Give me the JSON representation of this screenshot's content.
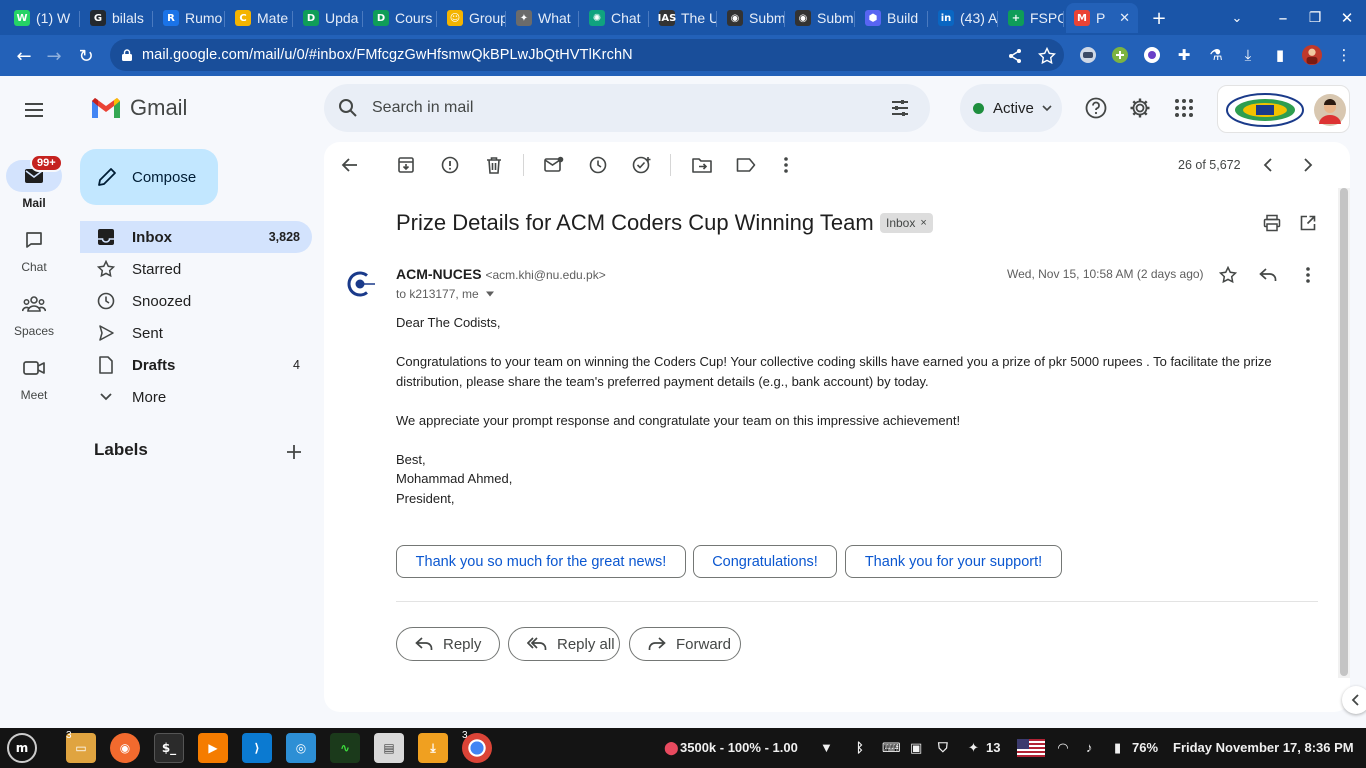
{
  "browser": {
    "tabs": [
      {
        "label": "(1) W",
        "color": "#25d366",
        "glyph": "W"
      },
      {
        "label": "bilals",
        "color": "#24292f",
        "glyph": "G"
      },
      {
        "label": "Rumo",
        "color": "#1a73e8",
        "glyph": "R"
      },
      {
        "label": "Mate",
        "color": "#f4b400",
        "glyph": "C"
      },
      {
        "label": "Upda",
        "color": "#0f9d58",
        "glyph": "D"
      },
      {
        "label": "Cours",
        "color": "#0f9d58",
        "glyph": "D"
      },
      {
        "label": "Group",
        "color": "#f4b400",
        "glyph": "☺"
      },
      {
        "label": "What",
        "color": "#6b6b6b",
        "glyph": "✦"
      },
      {
        "label": "Chat",
        "color": "#10a37f",
        "glyph": "✺"
      },
      {
        "label": "The U",
        "color": "#333333",
        "glyph": "IAS"
      },
      {
        "label": "Subm",
        "color": "#333333",
        "glyph": "◉"
      },
      {
        "label": "Subm",
        "color": "#333333",
        "glyph": "◉"
      },
      {
        "label": "Build",
        "color": "#5865f2",
        "glyph": "⬢"
      },
      {
        "label": "(43) A",
        "color": "#0a66c2",
        "glyph": "in"
      },
      {
        "label": "FSPC",
        "color": "#0f9d58",
        "glyph": "+"
      },
      {
        "label": "P",
        "color": "#ea4335",
        "glyph": "M"
      }
    ],
    "url": "mail.google.com/mail/u/0/#inbox/FMfcgzGwHfsmwQkBPLwJbQtHVTlKrchN"
  },
  "gmail": {
    "app_name": "Gmail",
    "search_placeholder": "Search in mail",
    "status": "Active",
    "rail": [
      {
        "label": "Mail",
        "badge": "99+"
      },
      {
        "label": "Chat"
      },
      {
        "label": "Spaces"
      },
      {
        "label": "Meet"
      }
    ],
    "compose_label": "Compose",
    "nav": [
      {
        "label": "Inbox",
        "count": "3,828"
      },
      {
        "label": "Starred",
        "count": ""
      },
      {
        "label": "Snoozed",
        "count": ""
      },
      {
        "label": "Sent",
        "count": ""
      },
      {
        "label": "Drafts",
        "count": "4"
      },
      {
        "label": "More",
        "count": ""
      }
    ],
    "labels_heading": "Labels"
  },
  "message": {
    "counter": "26 of 5,672",
    "subject": "Prize Details for ACM Coders Cup Winning Team",
    "label_chip": "Inbox",
    "sender_name": "ACM-NUCES",
    "sender_email": "<acm.khi@nu.edu.pk>",
    "to_line": "to k213177, me",
    "date": "Wed, Nov 15, 10:58 AM (2 days ago)",
    "greeting": "Dear The Codists,",
    "para1": "Congratulations to your team on winning the Coders Cup! Your collective coding skills have earned you a prize of pkr 5000 rupees . To facilitate the prize distribution, please share the team's preferred payment details (e.g., bank account) by today.",
    "para2": "We appreciate your prompt response and congratulate your team on this impressive achievement!",
    "signoff1": "Best,",
    "signoff2": "Mohammad Ahmed,",
    "signoff3": "President,",
    "smart_replies": [
      "Thank you so much for the great news!",
      "Congratulations!",
      "Thank you for your support!"
    ],
    "reply_label": "Reply",
    "reply_all_label": "Reply all",
    "forward_label": "Forward"
  },
  "taskbar": {
    "badge_files": "3",
    "badge_chrome": "3",
    "mining": "3500k - 100% - 1.00",
    "notifications": "13",
    "battery": "76%",
    "clock": "Friday November 17,  8:36 PM"
  }
}
